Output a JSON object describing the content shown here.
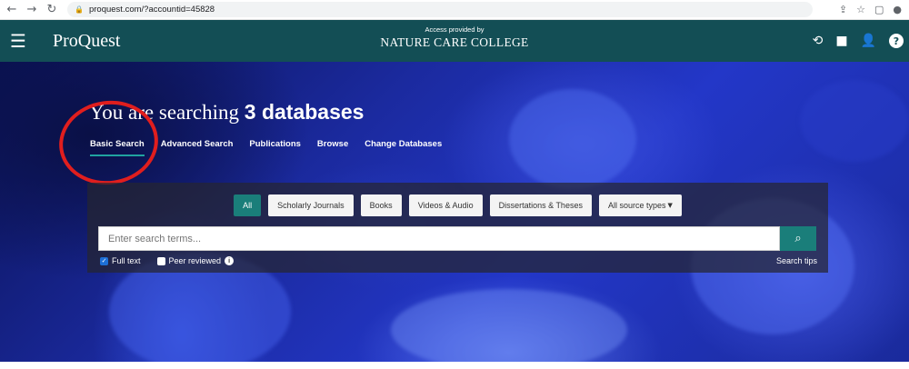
{
  "browser": {
    "url": "proquest.com/?accountid=45828"
  },
  "header": {
    "brand": "ProQuest",
    "provider_label": "Access provided by",
    "institution": "NATURE CARE COLLEGE"
  },
  "hero": {
    "title_prefix": "You are searching",
    "title_count": "3 databases",
    "nav": [
      {
        "label": "Basic Search",
        "active": true
      },
      {
        "label": "Advanced Search",
        "active": false
      },
      {
        "label": "Publications",
        "active": false
      },
      {
        "label": "Browse",
        "active": false
      },
      {
        "label": "Change Databases",
        "active": false
      }
    ]
  },
  "search": {
    "source_types": [
      {
        "label": "All",
        "active": true
      },
      {
        "label": "Scholarly Journals",
        "active": false
      },
      {
        "label": "Books",
        "active": false
      },
      {
        "label": "Videos & Audio",
        "active": false
      },
      {
        "label": "Dissertations & Theses",
        "active": false
      },
      {
        "label": "All source types",
        "active": false
      }
    ],
    "placeholder": "Enter search terms...",
    "options": {
      "full_text": {
        "label": "Full text",
        "checked": true
      },
      "peer_reviewed": {
        "label": "Peer reviewed",
        "checked": false
      }
    },
    "tips": "Search tips"
  },
  "colors": {
    "header_bg": "#134e55",
    "accent_teal": "#1a7e7a",
    "annotation_red": "#e01e1e"
  }
}
